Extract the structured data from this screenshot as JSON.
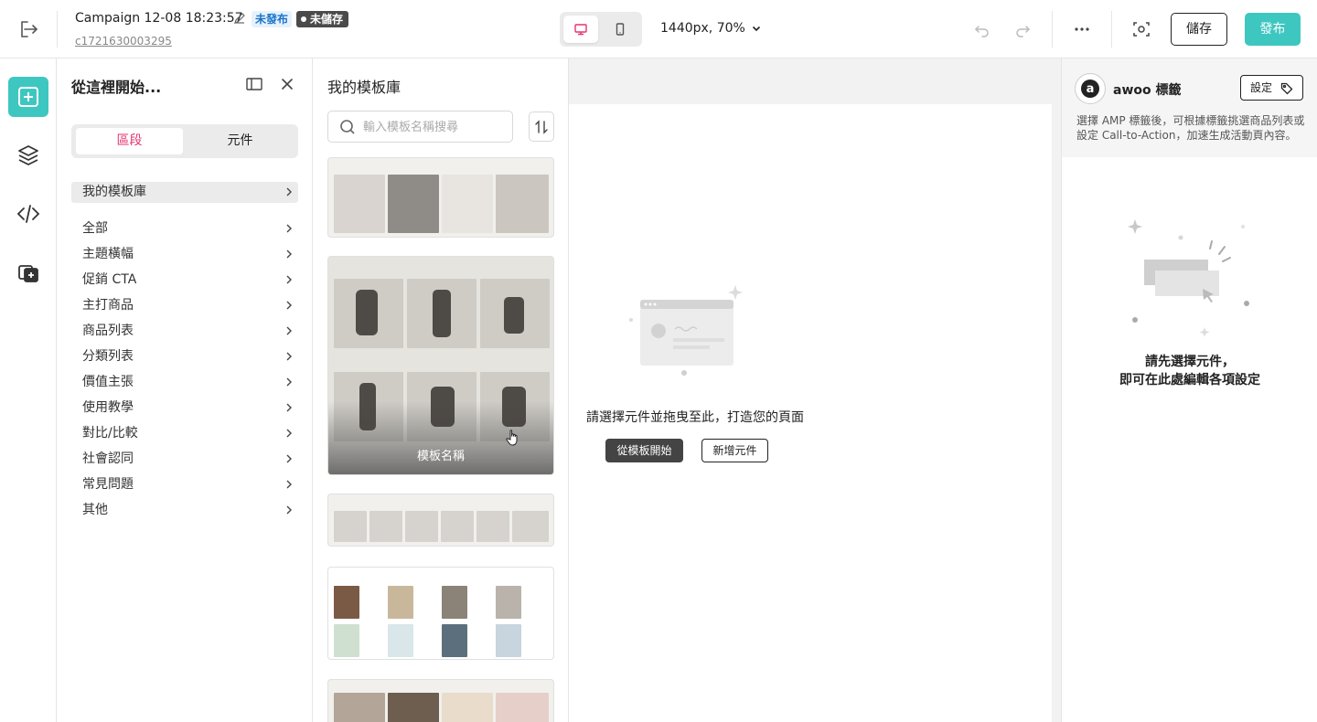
{
  "topbar": {
    "campaign_title": "Campaign 12-08 18:23:57",
    "status_unpublished": "未發布",
    "status_unsaved": "未儲存",
    "campaign_id": "c1721630003295",
    "zoom_label": "1440px, 70%",
    "save_label": "儲存",
    "publish_label": "發布"
  },
  "panel": {
    "title": "從這裡開始...",
    "seg_section": "區段",
    "seg_element": "元件",
    "active_category": "我的模板庫",
    "categories": [
      "全部",
      "主題橫幅",
      "促銷 CTA",
      "主打商品",
      "商品列表",
      "分類列表",
      "價值主張",
      "使用教學",
      "對比/比較",
      "社會認同",
      "常見問題",
      "其他"
    ]
  },
  "templates": {
    "title": "我的模板庫",
    "search_placeholder": "輸入模板名稱搜尋",
    "hover_name": "模板名稱"
  },
  "canvas": {
    "empty_text": "請選擇元件並拖曳至此，打造您的頁面",
    "start_from_template": "從模板開始",
    "add_element": "新增元件"
  },
  "right_panel": {
    "title": "awoo 標籤",
    "settings_label": "設定",
    "description": "選擇 AMP 標籤後，可根據標籤挑選商品列表或設定 Call-to-Action，加速生成活動頁內容。",
    "empty_line1": "請先選擇元件，",
    "empty_line2": "即可在此處編輯各項設定"
  },
  "colors": {
    "accent": "#3ec7c0",
    "active_segment": "#e5336f",
    "badge_blue": "#1a73c8"
  },
  "icons": {
    "exit": "exit-icon",
    "edit": "edit-icon",
    "desktop": "desktop-icon",
    "mobile": "mobile-icon",
    "undo": "undo-icon",
    "redo": "redo-icon",
    "more": "more-icon",
    "preview": "preview-icon",
    "add": "add-square-icon",
    "layers": "layers-icon",
    "code": "code-icon",
    "tag": "tag-icon"
  }
}
